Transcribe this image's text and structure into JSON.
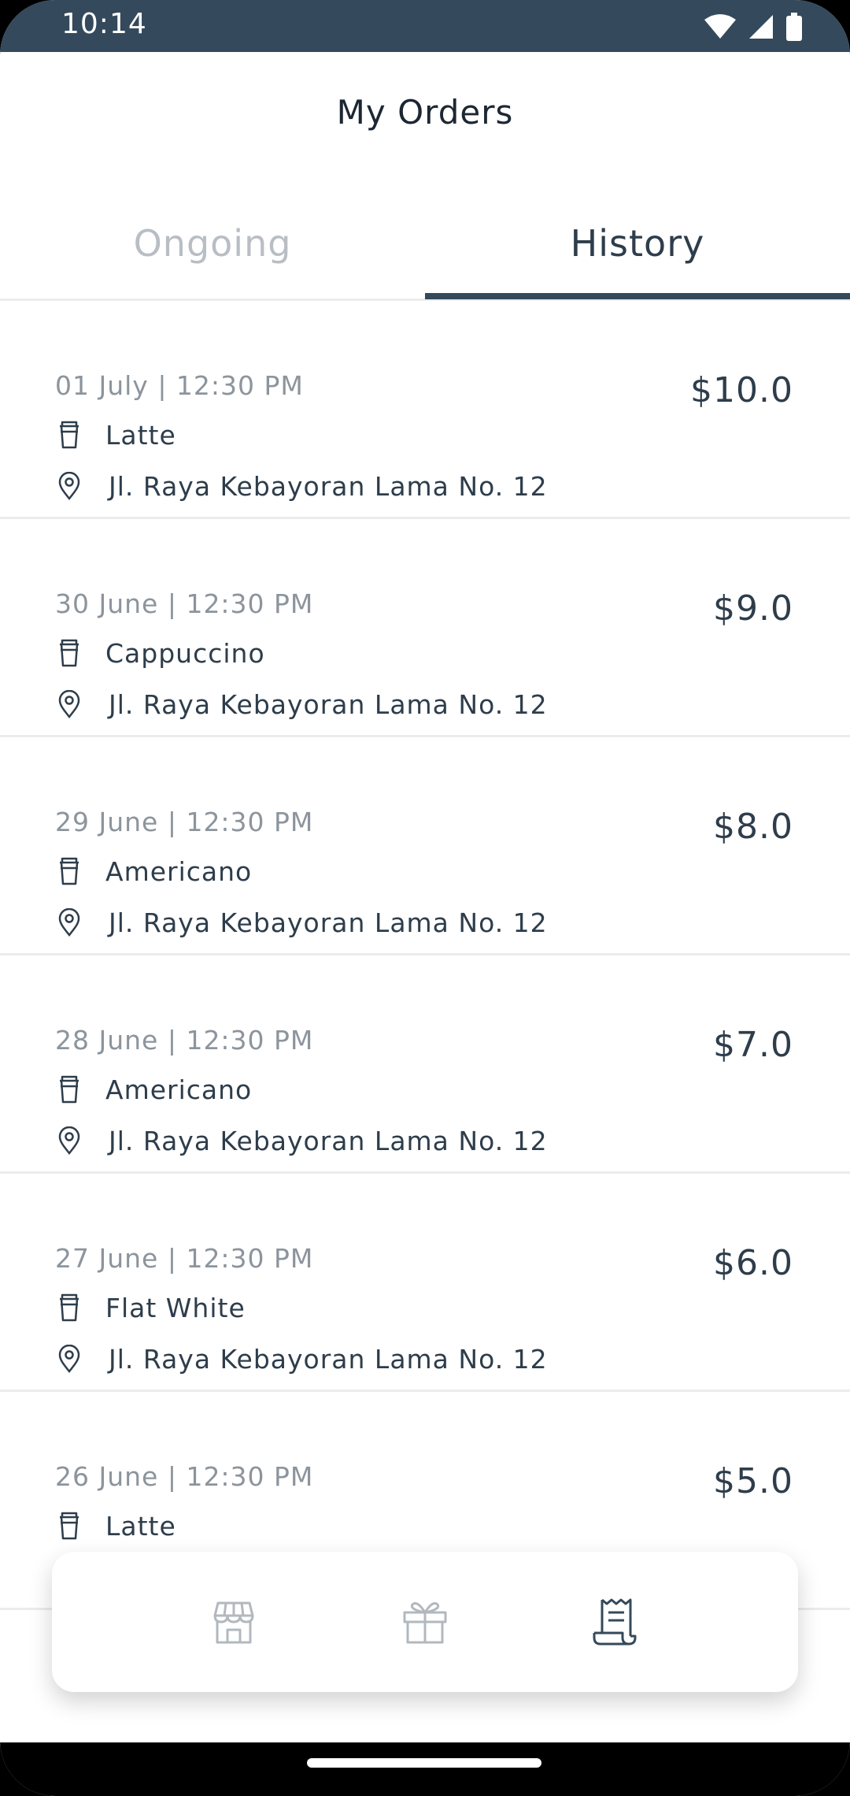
{
  "status": {
    "time": "10:14"
  },
  "header": {
    "title": "My Orders"
  },
  "tabs": [
    {
      "label": "Ongoing",
      "active": false
    },
    {
      "label": "History",
      "active": true
    }
  ],
  "orders": [
    {
      "date": "01 July | 12:30 PM",
      "item": "Latte",
      "address": "Jl. Raya Kebayoran Lama No. 12",
      "price": "$10.0"
    },
    {
      "date": "30 June | 12:30 PM",
      "item": "Cappuccino",
      "address": "Jl. Raya Kebayoran Lama No. 12",
      "price": "$9.0"
    },
    {
      "date": "29 June | 12:30 PM",
      "item": "Americano",
      "address": "Jl. Raya Kebayoran Lama No. 12",
      "price": "$8.0"
    },
    {
      "date": "28 June | 12:30 PM",
      "item": "Americano",
      "address": "Jl. Raya Kebayoran Lama No. 12",
      "price": "$7.0"
    },
    {
      "date": "27 June | 12:30 PM",
      "item": "Flat White",
      "address": "Jl. Raya Kebayoran Lama No. 12",
      "price": "$6.0"
    },
    {
      "date": "26 June | 12:30 PM",
      "item": "Latte",
      "address": "",
      "price": "$5.0"
    }
  ],
  "nav": [
    {
      "icon": "store-icon",
      "active": false
    },
    {
      "icon": "gift-icon",
      "active": false
    },
    {
      "icon": "receipt-icon",
      "active": true
    }
  ],
  "colors": {
    "primary": "#34495b",
    "text": "#2e3d4b",
    "muted": "#8c949c",
    "inactive_tab": "#b8bec4"
  }
}
